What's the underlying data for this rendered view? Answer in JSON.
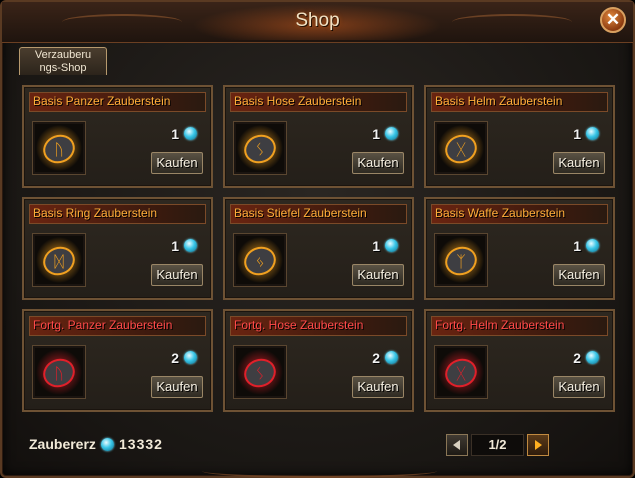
{
  "window": {
    "title": "Shop",
    "close_icon": "close-icon"
  },
  "tab": {
    "label": "Verzauberungs-Shop"
  },
  "buy_label": "Kaufen",
  "items": [
    {
      "name": "Basis Panzer Zauberstein",
      "price": "1",
      "tier": "basis",
      "rune": "rune-icon"
    },
    {
      "name": "Basis Hose Zauberstein",
      "price": "1",
      "tier": "basis",
      "rune": "rune-icon"
    },
    {
      "name": "Basis Helm Zauberstein",
      "price": "1",
      "tier": "basis",
      "rune": "rune-icon"
    },
    {
      "name": "Basis Ring Zauberstein",
      "price": "1",
      "tier": "basis",
      "rune": "rune-icon"
    },
    {
      "name": "Basis Stiefel Zauberstein",
      "price": "1",
      "tier": "basis",
      "rune": "rune-icon"
    },
    {
      "name": "Basis Waffe Zauberstein",
      "price": "1",
      "tier": "basis",
      "rune": "rune-icon"
    },
    {
      "name": "Fortg. Panzer Zauberstein",
      "price": "2",
      "tier": "advanced",
      "rune": "rune-icon"
    },
    {
      "name": "Fortg. Hose Zauberstein",
      "price": "2",
      "tier": "advanced",
      "rune": "rune-icon"
    },
    {
      "name": "Fortg. Helm Zauberstein",
      "price": "2",
      "tier": "advanced",
      "rune": "rune-icon"
    }
  ],
  "currency": {
    "label": "Zaubererz",
    "value": "13332",
    "icon": "gem-icon"
  },
  "pager": {
    "text": "1/2"
  },
  "colors": {
    "basis_name": "#ffae3a",
    "advanced_name": "#ff4a4a",
    "gem": "#39c6e8",
    "basis_glow": "#f0a020",
    "advanced_glow": "#e0202a"
  }
}
